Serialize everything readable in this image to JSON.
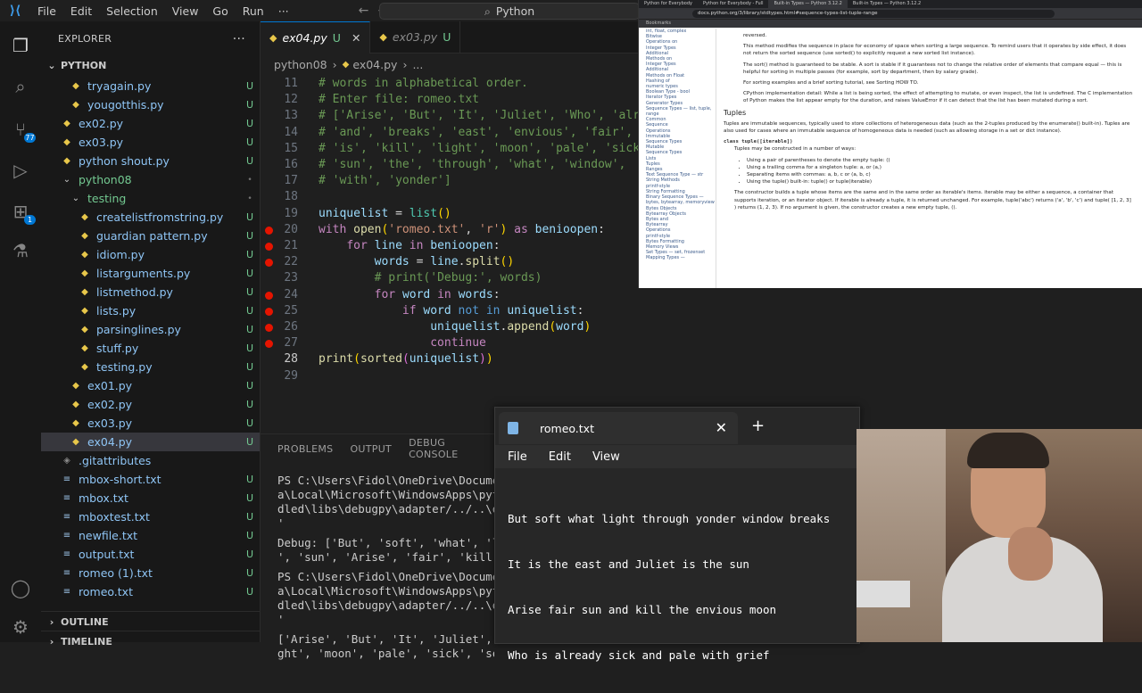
{
  "titlebar": {
    "menus": [
      "File",
      "Edit",
      "Selection",
      "View",
      "Go",
      "Run"
    ],
    "more": "···",
    "search": "Python"
  },
  "activity": {
    "scm_badge": "77",
    "ext_badge": "1"
  },
  "explorer": {
    "title": "EXPLORER",
    "more": "···",
    "root": "PYTHON",
    "rows": [
      {
        "label": "tryagain.py",
        "status": "U",
        "type": "py",
        "indent": 2
      },
      {
        "label": "yougotthis.py",
        "status": "U",
        "type": "py",
        "indent": 2
      },
      {
        "label": "ex02.py",
        "status": "U",
        "type": "py",
        "indent": 1
      },
      {
        "label": "ex03.py",
        "status": "U",
        "type": "py",
        "indent": 1
      },
      {
        "label": "python shout.py",
        "status": "U",
        "type": "py",
        "indent": 1
      },
      {
        "label": "python08",
        "status": "•",
        "type": "folder",
        "indent": 1
      },
      {
        "label": "testing",
        "status": "•",
        "type": "folder",
        "indent": 2
      },
      {
        "label": "createlistfromstring.py",
        "status": "U",
        "type": "py",
        "indent": 3
      },
      {
        "label": "guardian pattern.py",
        "status": "U",
        "type": "py",
        "indent": 3
      },
      {
        "label": "idiom.py",
        "status": "U",
        "type": "py",
        "indent": 3
      },
      {
        "label": "listarguments.py",
        "status": "U",
        "type": "py",
        "indent": 3
      },
      {
        "label": "listmethod.py",
        "status": "U",
        "type": "py",
        "indent": 3
      },
      {
        "label": "lists.py",
        "status": "U",
        "type": "py",
        "indent": 3
      },
      {
        "label": "parsinglines.py",
        "status": "U",
        "type": "py",
        "indent": 3
      },
      {
        "label": "stuff.py",
        "status": "U",
        "type": "py",
        "indent": 3
      },
      {
        "label": "testing.py",
        "status": "U",
        "type": "py",
        "indent": 3
      },
      {
        "label": "ex01.py",
        "status": "U",
        "type": "py",
        "indent": 2
      },
      {
        "label": "ex02.py",
        "status": "U",
        "type": "py",
        "indent": 2
      },
      {
        "label": "ex03.py",
        "status": "U",
        "type": "py",
        "indent": 2
      },
      {
        "label": "ex04.py",
        "status": "U",
        "type": "py",
        "indent": 2,
        "selected": true
      },
      {
        "label": ".gitattributes",
        "status": "",
        "type": "git",
        "indent": 1
      },
      {
        "label": "mbox-short.txt",
        "status": "U",
        "type": "txt",
        "indent": 1
      },
      {
        "label": "mbox.txt",
        "status": "U",
        "type": "txt",
        "indent": 1
      },
      {
        "label": "mboxtest.txt",
        "status": "U",
        "type": "txt",
        "indent": 1
      },
      {
        "label": "newfile.txt",
        "status": "U",
        "type": "txt",
        "indent": 1
      },
      {
        "label": "output.txt",
        "status": "U",
        "type": "txt",
        "indent": 1
      },
      {
        "label": "romeo (1).txt",
        "status": "U",
        "type": "txt",
        "indent": 1
      },
      {
        "label": "romeo.txt",
        "status": "U",
        "type": "txt",
        "indent": 1
      }
    ],
    "outline": "OUTLINE",
    "timeline": "TIMELINE"
  },
  "tabs": [
    {
      "label": "ex04.py",
      "status": "U",
      "active": true
    },
    {
      "label": "ex03.py",
      "status": "U",
      "active": false
    }
  ],
  "breadcrumb": {
    "folder": "python08",
    "file": "ex04.py",
    "rest": "..."
  },
  "code": [
    {
      "n": "11",
      "html": "<span class='cm'># words in alphabetical order.</span>"
    },
    {
      "n": "12",
      "html": "<span class='cm'># Enter file: romeo.txt</span>"
    },
    {
      "n": "13",
      "html": "<span class='cm'># ['Arise', 'But', 'It', 'Juliet', 'Who', 'alread</span>"
    },
    {
      "n": "14",
      "html": "<span class='cm'># 'and', 'breaks', 'east', 'envious', 'fair', 'gr</span>"
    },
    {
      "n": "15",
      "html": "<span class='cm'># 'is', 'kill', 'light', 'moon', 'pale', 'sick', </span>"
    },
    {
      "n": "16",
      "html": "<span class='cm'># 'sun', 'the', 'through', 'what', 'window',</span>"
    },
    {
      "n": "17",
      "html": "<span class='cm'># 'with', 'yonder']</span>"
    },
    {
      "n": "18",
      "html": ""
    },
    {
      "n": "19",
      "html": "<span class='vr'>uniquelist</span> <span class='pn'>=</span> <span class='bi'>list</span><span class='br2'>()</span>"
    },
    {
      "n": "20",
      "bp": true,
      "html": "<span class='kw'>with</span> <span class='fn'>open</span><span class='br2'>(</span><span class='st2'>'romeo.txt'</span><span class='pn'>,</span> <span class='st2'>'r'</span><span class='br2'>)</span> <span class='kw'>as</span> <span class='vr'>benioopen</span><span class='pn'>:</span>"
    },
    {
      "n": "21",
      "bp": true,
      "html": "    <span class='kw'>for</span> <span class='vr'>line</span> <span class='kw'>in</span> <span class='vr'>benioopen</span><span class='pn'>:</span>"
    },
    {
      "n": "22",
      "bp": true,
      "html": "        <span class='vr'>words</span> <span class='pn'>=</span> <span class='vr'>line</span><span class='pn'>.</span><span class='fn'>split</span><span class='br2'>()</span>"
    },
    {
      "n": "23",
      "html": "        <span class='cm'># print('Debug:', words)</span>"
    },
    {
      "n": "24",
      "bp": true,
      "html": "        <span class='kw'>for</span> <span class='vr'>word</span> <span class='kw'>in</span> <span class='vr'>words</span><span class='pn'>:</span>"
    },
    {
      "n": "25",
      "bp": true,
      "html": "            <span class='kw'>if</span> <span class='vr'>word</span> <span class='op'>not in</span> <span class='vr'>uniquelist</span><span class='pn'>:</span>"
    },
    {
      "n": "26",
      "bp": true,
      "html": "                <span class='vr'>uniquelist</span><span class='pn'>.</span><span class='fn'>append</span><span class='br2'>(</span><span class='vr'>word</span><span class='br2'>)</span>"
    },
    {
      "n": "27",
      "bp": true,
      "html": "                <span class='kw'>continue</span>"
    },
    {
      "n": "28",
      "cur": true,
      "html": "<span class='fn'>print</span><span class='br2'>(</span><span class='fn'>sorted</span><span class='br'>(</span><span class='vr'>uniquelist</span><span class='br'>)</span><span class='br2'>)</span>"
    },
    {
      "n": "29",
      "html": ""
    }
  ],
  "panel": {
    "tabs": [
      "PROBLEMS",
      "OUTPUT",
      "DEBUG CONSOLE"
    ],
    "terminal": [
      "PS C:\\Users\\Fidol\\OneDrive\\Documents",
      "a\\Local\\Microsoft\\WindowsApps\\python",
      "dled\\libs\\debugpy\\adapter/../..\\debu",
      "'",
      "Debug: ['But', 'soft', 'what', 'ligh",
      "', 'sun', 'Arise', 'fair', 'kill', '",
      "PS C:\\Users\\Fidol\\OneDrive\\Documents",
      "a\\Local\\Microsoft\\WindowsApps\\python",
      "dled\\libs\\debugpy\\adapter/../..\\debu",
      "'",
      "['Arise', 'But', 'It', 'Juliet', 'Wh",
      "ght', 'moon', 'pale', 'sick', 'soft'"
    ]
  },
  "browser": {
    "tabs": [
      "Python for Everybody",
      "Python for Everybody - Full",
      "Built-in Types — Python 3.12.2",
      "Built-in Types — Python 3.12.2"
    ],
    "url": "docs.python.org/3/library/stdtypes.html#sequence-types-list-tuple-range",
    "bookmarks": "Bookmarks",
    "sidebar": [
      "int, float, complex",
      "Bitwise",
      "Operations on",
      "Integer Types",
      "Additional",
      "Methods on",
      "Integer Types",
      "Additional",
      "Methods on Float",
      "Hashing of",
      "numeric types",
      "Boolean Type - bool",
      "Iterator Types",
      "Generator Types",
      "Sequence Types — list, tuple, range",
      "Common",
      "Sequence",
      "Operations",
      "Immutable",
      "Sequence Types",
      "Mutable",
      "Sequence Types",
      "Lists",
      "Tuples",
      "Ranges",
      "Text Sequence Type — str",
      "String Methods",
      "printf-style",
      "String Formatting",
      "Binary Sequence Types — bytes, bytearray, memoryview",
      "Bytes Objects",
      "Bytearray Objects",
      "Bytes and",
      "Bytearray",
      "Operations",
      "printf-style",
      "Bytes Formatting",
      "Memory Views",
      "Set Types — set, frozenset",
      "Mapping Types —"
    ],
    "para1": "reversed.",
    "para2": "This method modifies the sequence in place for economy of space when sorting a large sequence. To remind users that it operates by side effect, it does not return the sorted sequence (use sorted() to explicitly request a new sorted list instance).",
    "para3": "The sort() method is guaranteed to be stable. A sort is stable if it guarantees not to change the relative order of elements that compare equal — this is helpful for sorting in multiple passes (for example, sort by department, then by salary grade).",
    "para4": "For sorting examples and a brief sorting tutorial, see Sorting HOW TO.",
    "para5": "CPython implementation detail: While a list is being sorted, the effect of attempting to mutate, or even inspect, the list is undefined. The C implementation of Python makes the list appear empty for the duration, and raises ValueError if it can detect that the list has been mutated during a sort.",
    "heading": "Tuples",
    "para6": "Tuples are immutable sequences, typically used to store collections of heterogeneous data (such as the 2-tuples produced by the enumerate() built-in). Tuples are also used for cases where an immutable sequence of homogeneous data is needed (such as allowing storage in a set or dict instance).",
    "classline": "class tuple([iterable])",
    "para7": "Tuples may be constructed in a number of ways:",
    "bullets": [
      "Using a pair of parentheses to denote the empty tuple: ()",
      "Using a trailing comma for a singleton tuple: a, or (a,)",
      "Separating items with commas: a, b, c or (a, b, c)",
      "Using the tuple() built-in: tuple() or tuple(iterable)"
    ],
    "para8": "The constructor builds a tuple whose items are the same and in the same order as iterable's items. iterable may be either a sequence, a container that supports iteration, or an iterator object. If iterable is already a tuple, it is returned unchanged. For example, tuple('abc') returns ('a', 'b', 'c') and tuple( [1, 2, 3] ) returns (1, 2, 3). If no argument is given, the constructor creates a new empty tuple, ()."
  },
  "notepad": {
    "title": "romeo.txt",
    "close": "✕",
    "plus": "+",
    "menus": [
      "File",
      "Edit",
      "View"
    ],
    "lines": [
      "But soft what light through yonder window breaks",
      "It is the east and Juliet is the sun",
      "Arise fair sun and kill the envious moon",
      "Who is already sick and pale with grief"
    ]
  }
}
